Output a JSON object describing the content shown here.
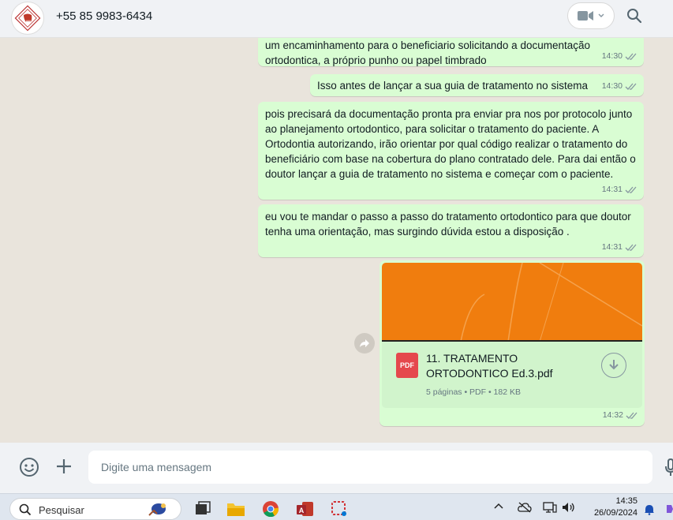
{
  "header": {
    "contact_name": "+55 85 9983-6434",
    "avatar_icon": "tooth-logo-icon",
    "video_icon": "video-camera-icon",
    "search_icon": "search-icon"
  },
  "messages": [
    {
      "text": "um encaminhamento para o beneficiario solicitando a documentação ortodontica, a próprio punho ou papel timbrado",
      "time": "14:30"
    },
    {
      "text": "Isso antes de lançar a sua guia de tratamento no sistema",
      "time": "14:30"
    },
    {
      "text": "pois precisará da documentação pronta pra enviar pra nos por protocolo junto ao planejamento ortodontico, para solicitar o tratamento do paciente. A Ortodontia autorizando, irão orientar por qual código realizar o tratamento do beneficiário com base na cobertura do plano contratado dele. Para dai então o doutor lançar a guia de tratamento no sistema e começar com o paciente.",
      "time": "14:31"
    },
    {
      "text": "eu vou te mandar o passo a passo do tratamento ortodontico para que doutor tenha uma orientação, mas surgindo dúvida estou a disposição .",
      "time": "14:31"
    }
  ],
  "document": {
    "icon_label": "PDF",
    "file_name": "11. TRATAMENTO ORTODONTICO Ed.3.pdf",
    "info": "5 páginas • PDF • 182 KB",
    "time": "14:32",
    "thumb_color": "#f07d0e"
  },
  "composer": {
    "placeholder": "Digite uma mensagem"
  },
  "taskbar": {
    "search_label": "Pesquisar",
    "time": "14:35",
    "date": "26/09/2024"
  },
  "colors": {
    "outgoing_bubble": "#d9fdd3",
    "chat_background": "#e9e4dc",
    "header_background": "#f0f2f5"
  }
}
